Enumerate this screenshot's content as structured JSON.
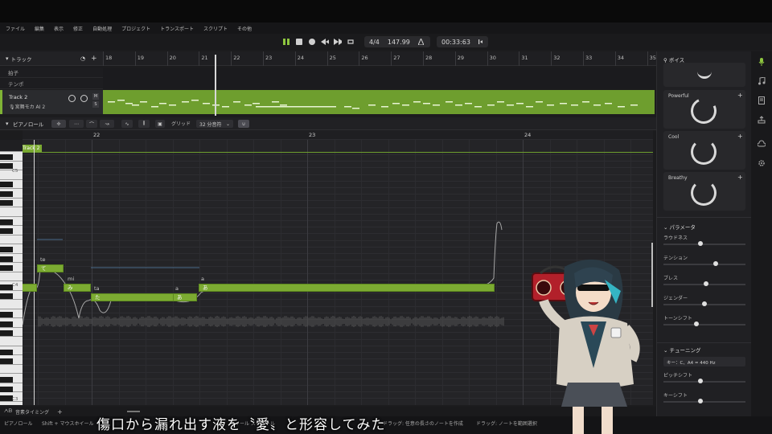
{
  "menu": [
    "ファイル",
    "編集",
    "表示",
    "修正",
    "自動処理",
    "プロジェクト",
    "トランスポート",
    "スクリプト",
    "その他"
  ],
  "transport": {
    "time_signature": "4/4",
    "tempo": "147.99",
    "time": "00:33:63"
  },
  "tracks_panel": {
    "title": "トラック",
    "rows": [
      "拍子",
      "テンポ"
    ],
    "track_name": "Track 2",
    "voice_name": "宮舞モカ AI 2",
    "mute": "M",
    "solo": "S"
  },
  "ruler_bars": [
    "18",
    "19",
    "20",
    "21",
    "22",
    "23",
    "24",
    "25",
    "26",
    "27",
    "28",
    "29",
    "30",
    "31",
    "32",
    "33",
    "34",
    "35"
  ],
  "piano_roll": {
    "title": "ピアノロール",
    "grid_label": "グリッド",
    "grid_value": "32 分音符",
    "bars": [
      "22",
      "23",
      "24"
    ],
    "track_tag": "Track 2",
    "key_labels": [
      "C5",
      "C4",
      "C3"
    ],
    "notes": [
      {
        "lyric": "te",
        "text": "て"
      },
      {
        "lyric": "mi",
        "text": "み"
      },
      {
        "lyric": "ta",
        "text": "た"
      },
      {
        "lyric": "a",
        "text": "あ"
      },
      {
        "lyric": "a",
        "text": "あ"
      }
    ],
    "timing_tab": "音素タイミング"
  },
  "right_panel": {
    "voice_title": "ボイス",
    "voice_cards": [
      "Powerful",
      "Cool",
      "Breathy"
    ],
    "param_title": "パラメータ",
    "params": [
      {
        "label": "ラウドネス",
        "value": 0.45
      },
      {
        "label": "テンション",
        "value": 0.65
      },
      {
        "label": "ブレス",
        "value": 0.52
      },
      {
        "label": "ジェンダー",
        "value": 0.5
      },
      {
        "label": "トーンシフト",
        "value": 0.4
      }
    ],
    "tuning_title": "チューニング",
    "key_value": "キー：C、A4 = 440 Hz",
    "tuning_sliders": [
      {
        "label": "ピッチシフト",
        "value": 0.45
      },
      {
        "label": "キーシフト",
        "value": 0.45
      }
    ]
  },
  "status": {
    "mode": "ピアノロール",
    "hint1": "Shift + マウスホイール",
    "hint2": "ホイール スクロール",
    "hint3": "ドラッグ: 任意の長さのノートを作成",
    "hint4": "ドラッグ: ノートを範囲選択"
  },
  "subtitle": "傷口から漏れ出す液を〝愛〟と形容してみた",
  "colors": {
    "accent": "#7cab32",
    "play": "#8ec63f",
    "background": "#1c1c1e"
  }
}
